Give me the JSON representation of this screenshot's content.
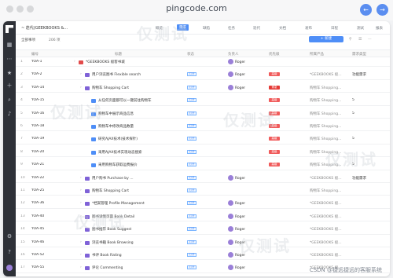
{
  "browser": {
    "url": "pingcode.com"
  },
  "header": {
    "project": "~ 迭代(GEEKBOOKS &...",
    "tabs": [
      "概览",
      "需求",
      "缺陷",
      "任务",
      "迭代",
      "文档",
      "发布",
      "日程",
      "测试",
      "报表"
    ],
    "active_tab": 1
  },
  "toolbar": {
    "filter_label": "全部事项",
    "count_label": "206 项",
    "new_button": "+ 新建"
  },
  "columns": [
    "编号",
    "标题",
    "状态",
    "负责人",
    "优先级",
    "所属产品",
    "需求类型"
  ],
  "rows": [
    {
      "id": "YOA-1",
      "title": "*GEEKBOOKS 极客书城",
      "status": "",
      "owner": "Roger",
      "priority": "",
      "product": "",
      "type": "",
      "indent": 0,
      "color": "#e24a4a"
    },
    {
      "id": "YOA-2",
      "title": "用户浏览图书 Flexible search",
      "status": "打开",
      "owner": "Roger",
      "priority": "高级",
      "product": "*GEEKBOOKS 极...",
      "type": "功能需求",
      "indent": 1,
      "color": "#7f62d7"
    },
    {
      "id": "YOA-14",
      "title": "购物车 Shopping Cart",
      "status": "打开",
      "owner": "Roger",
      "priority": "紧急",
      "product": "购物车 Shopping...",
      "type": "",
      "indent": 1,
      "color": "#7f62d7"
    },
    {
      "id": "YOA-15",
      "title": "从任何页面都可以一键前往购物车",
      "status": "打开",
      "owner": "",
      "priority": "高级",
      "product": "购物车 Shopping...",
      "type": "5",
      "indent": 2,
      "color": "#4e8ef7"
    },
    {
      "id": "YOA-16",
      "title": "购物车中展示商品信息",
      "status": "打开",
      "owner": "",
      "priority": "高级",
      "product": "购物车 Shopping...",
      "type": "5",
      "indent": 2,
      "color": "#4e8ef7"
    },
    {
      "id": "YOA-18",
      "title": "购物车中修改商品数量",
      "status": "打开",
      "owner": "",
      "priority": "高级",
      "product": "购物车 Shopping...",
      "type": "",
      "indent": 2,
      "color": "#4e8ef7"
    },
    {
      "id": "YOA-19",
      "title": "研究AJAX技术(技术探针)",
      "status": "打开",
      "owner": "",
      "priority": "高级",
      "product": "购物车 Shopping...",
      "type": "5",
      "indent": 2,
      "color": "#4e8ef7"
    },
    {
      "id": "YOA-20",
      "title": "采用AJAX技术实现动态搜索",
      "status": "打开",
      "owner": "",
      "priority": "高级",
      "product": "购物车 Shopping...",
      "type": "",
      "indent": 2,
      "color": "#4e8ef7"
    },
    {
      "id": "YOA-21",
      "title": "采用购物车获取运费报价",
      "status": "打开",
      "owner": "",
      "priority": "高级",
      "product": "购物车 Shopping...",
      "type": "5",
      "indent": 2,
      "color": "#4e8ef7"
    },
    {
      "id": "YOA-22",
      "title": "用户购书 Purchase by ...",
      "status": "打开",
      "owner": "Roger",
      "priority": "",
      "product": "*GEEKBOOKS 极...",
      "type": "功能需求",
      "indent": 1,
      "color": "#7f62d7"
    },
    {
      "id": "YOA-25",
      "title": "购物车 Shopping Cart",
      "status": "打开",
      "owner": "",
      "priority": "",
      "product": "购物车 Shopping...",
      "type": "",
      "indent": 1,
      "color": "#7f62d7"
    },
    {
      "id": "YOA-36",
      "title": "*档案管理 Profile Management",
      "status": "打开",
      "owner": "Roger",
      "priority": "",
      "product": "*GEEKBOOKS 极...",
      "type": "",
      "indent": 1,
      "color": "#7f62d7"
    },
    {
      "id": "YOA-40",
      "title": "图书详情页面 Book Detail",
      "status": "打开",
      "owner": "Roger",
      "priority": "",
      "product": "*GEEKBOOKS 极...",
      "type": "",
      "indent": 1,
      "color": "#7f62d7"
    },
    {
      "id": "YOA-45",
      "title": "图书推荐 Book Suggest",
      "status": "打开",
      "owner": "Roger",
      "priority": "",
      "product": "*GEEKBOOKS 极...",
      "type": "",
      "indent": 1,
      "color": "#7f62d7"
    },
    {
      "id": "YOA-46",
      "title": "浏览书籍 Book Browsing",
      "status": "打开",
      "owner": "Roger",
      "priority": "",
      "product": "*GEEKBOOKS 极...",
      "type": "",
      "indent": 1,
      "color": "#7f62d7"
    },
    {
      "id": "YOA-52",
      "title": "书评 Book Rating",
      "status": "打开",
      "owner": "Roger",
      "priority": "",
      "product": "*GEEKBOOKS 极...",
      "type": "",
      "indent": 1,
      "color": "#7f62d7"
    },
    {
      "id": "YOA-55",
      "title": "评论 Commenting",
      "status": "打开",
      "owner": "Roger",
      "priority": "",
      "product": "*GEEKBOOKS 极...",
      "type": "",
      "indent": 1,
      "color": "#7f62d7"
    }
  ],
  "priority_colors": {
    "高级": "#f05a5a",
    "紧急": "#e53935"
  },
  "watermark": "仅测试",
  "footer": "CSDN @捷远捷远的客服系统"
}
